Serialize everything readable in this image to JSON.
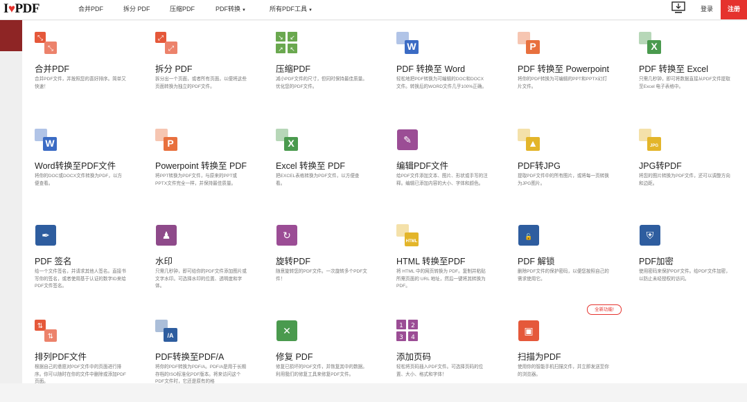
{
  "header": {
    "logo_i": "I",
    "logo_pdf": "PDF",
    "nav": [
      {
        "label": "合并PDF"
      },
      {
        "label": "拆分 PDF"
      },
      {
        "label": "压缩PDF"
      },
      {
        "label": "PDF转换",
        "caret": "▼"
      },
      {
        "label": "所有PDF工具",
        "caret": "▼"
      }
    ],
    "login": "登录",
    "register": "注册"
  },
  "new_badge": "全新功能!",
  "tools": [
    {
      "title": "合并PDF",
      "desc": "合并PDF文件，并按照您的喜好排序。简单又快速！",
      "icon": "merge-icon",
      "color": "#e5583a"
    },
    {
      "title": "拆分 PDF",
      "desc": "拆分出一个页面，或者所有页面，以便将这些页面转换为独立的PDF文件。",
      "icon": "split-icon",
      "color": "#e5583a"
    },
    {
      "title": "压缩PDF",
      "desc": "减小PDF文件的尺寸，但同时保持最佳质量。优化您的PDF文件。",
      "icon": "compress-icon",
      "color": "#6aa84f"
    },
    {
      "title": "PDF 转换至 Word",
      "desc": "轻松地把PDF转换为可编辑的DOC和DOCX文件。转换后的WORD文件几乎100%正确。",
      "icon": "pdf-to-word-icon",
      "color": "#3b6bc4"
    },
    {
      "title": "PDF 转换至 Powerpoint",
      "desc": "将你的PDF转换为可编辑的PPT和PPTX幻灯片文件。",
      "icon": "pdf-to-powerpoint-icon",
      "color": "#e8703e"
    },
    {
      "title": "PDF 转换至 Excel",
      "desc": "只需几秒钟，即可将数据直接从PDF文件提取至Excel 电子表格中。",
      "icon": "pdf-to-excel-icon",
      "color": "#4a9a4e"
    },
    {
      "title": "Word转换至PDF文件",
      "desc": "将你的DOC或DOCX文件转换为PDF，以方便查看。",
      "icon": "word-to-pdf-icon",
      "color": "#3b6bc4"
    },
    {
      "title": "Powerpoint 转换至 PDF",
      "desc": "将PPT转换为PDF文件，与原来的PPT或PPTX文件完全一样，并保持最佳质量。",
      "icon": "powerpoint-to-pdf-icon",
      "color": "#e8703e"
    },
    {
      "title": "Excel 转换至 PDF",
      "desc": "把EXCEL表格转换为PDF文件，以方便查看。",
      "icon": "excel-to-pdf-icon",
      "color": "#4a9a4e"
    },
    {
      "title": "编辑PDF文件",
      "desc": "给PDF文件添加文本、图片、形状或手写的注释。编辑已添加内容的大小、字体和颜色。",
      "icon": "edit-pdf-icon",
      "color": "#9b4d95"
    },
    {
      "title": "PDF转JPG",
      "desc": "提取PDF文件中的所有图片，或将每一页转换为JPG图片。",
      "icon": "pdf-to-jpg-icon",
      "color": "#e3b52a"
    },
    {
      "title": "JPG转PDF",
      "desc": "将您的图片转换为PDF文件，还可以调整方向和边距。",
      "icon": "jpg-to-pdf-icon",
      "color": "#e3b52a"
    },
    {
      "title": "PDF 签名",
      "desc": "给一个文件签名，并请求其他人签名。直接书写你的签名，或者使用基于认证的数字ID来给PDF文件签名。",
      "icon": "sign-pdf-icon",
      "color": "#2e5d9f"
    },
    {
      "title": "水印",
      "desc": "只需几秒钟，即可给你的PDF文件添加图片或文字水印。可选择水印的位置、透明度和字体。",
      "icon": "watermark-icon",
      "color": "#8e4a8a"
    },
    {
      "title": "旋转PDF",
      "desc": "随意旋转您的PDF文件。一次旋转多个PDF文件！",
      "icon": "rotate-pdf-icon",
      "color": "#9b4d95"
    },
    {
      "title": "HTML 转换至PDF",
      "desc": "将 HTML 中的网页转换为 PDF。复制并粘贴所需页面的 URL 地址，然后一键将其转换为 PDF。",
      "icon": "html-to-pdf-icon",
      "color": "#e3b52a"
    },
    {
      "title": "PDF 解锁",
      "desc": "删除PDF文件的保护密码，以便您按照自己的需求使用它。",
      "icon": "unlock-pdf-icon",
      "color": "#2e5d9f"
    },
    {
      "title": "PDF加密",
      "desc": "使用密码来保护PDF文件。给PDF文件加密，以防止未经授权的访问。",
      "icon": "protect-pdf-icon",
      "color": "#2e5d9f"
    },
    {
      "title": "排列PDF文件",
      "desc": "根据自己的意愿对PDF文件中的页面进行排序。你可以随时在你的文件中删除或添加PDF页面。",
      "icon": "organize-pdf-icon",
      "color": "#e5583a"
    },
    {
      "title": "PDF转换至PDF/A",
      "desc": "将你的PDF转换为PDF/A。PDF/A是用于长期存档的ISO标准化PDF版本。将来访问这个PDF文件时，它还是原有的格",
      "icon": "pdf-to-pdfa-icon",
      "color": "#2e5d9f"
    },
    {
      "title": "修复 PDF",
      "desc": "修复已损坏的PDF文件，并恢复其中的数据。利用我们的修复工具来修复PDF文件。",
      "icon": "repair-pdf-icon",
      "color": "#4a9a4e"
    },
    {
      "title": "添加页码",
      "desc": "轻松将页码插入PDF文件。可选择页码的位置、大小、格式和字体！",
      "icon": "page-numbers-icon",
      "color": "#9b4d95"
    },
    {
      "title": "扫描为PDF",
      "desc": "使用你的智能手机扫描文件，并立即发送至你的浏览器。",
      "icon": "scan-to-pdf-icon",
      "color": "#e5583a"
    }
  ]
}
